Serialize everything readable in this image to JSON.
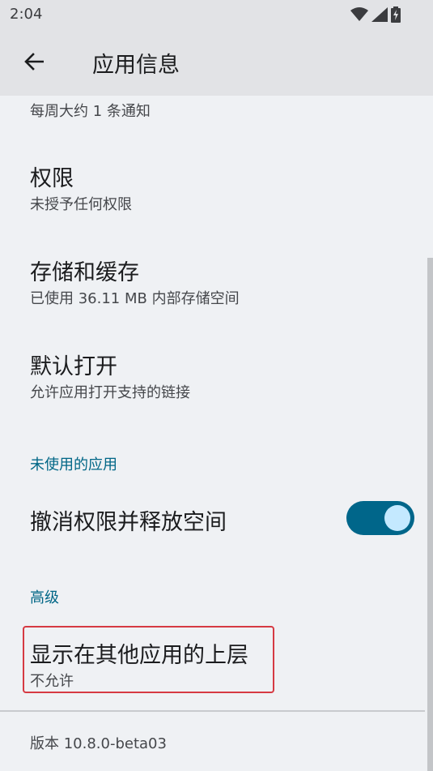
{
  "status_bar": {
    "time": "2:04",
    "icons": [
      "wifi-icon",
      "signal-icon",
      "battery-icon"
    ]
  },
  "app_bar": {
    "back_icon": "arrow-left-icon",
    "title": "应用信息"
  },
  "notifications": {
    "summary": "每周大约 1 条通知"
  },
  "items": {
    "permissions": {
      "title": "权限",
      "subtitle": "未授予任何权限"
    },
    "storage": {
      "title": "存储和缓存",
      "subtitle": "已使用 36.11 MB 内部存储空间"
    },
    "open_by_default": {
      "title": "默认打开",
      "subtitle": "允许应用打开支持的链接"
    },
    "unused_apps": {
      "header": "未使用的应用",
      "toggle_label": "撤消权限并释放空间",
      "toggle_on": true
    },
    "advanced": {
      "header": "高级",
      "overlay_title": "显示在其他应用的上层",
      "overlay_subtitle": "不允许"
    }
  },
  "footer": {
    "version": "版本 10.8.0-beta03"
  },
  "colors": {
    "accent": "#00668a",
    "highlight": "#d63a43"
  }
}
